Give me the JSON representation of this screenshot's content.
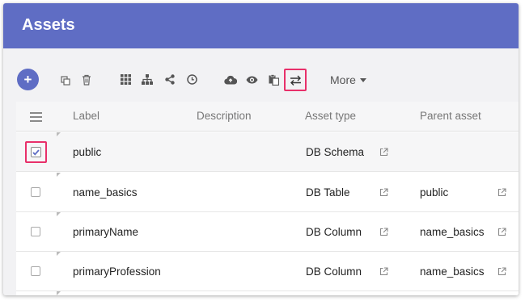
{
  "header": {
    "title": "Assets",
    "color": "#5f6dc4"
  },
  "toolbar": {
    "add_label": "+",
    "more_label": "More",
    "icons": [
      "add-icon",
      "copy-icon",
      "trash-icon",
      "grid-icon",
      "hierarchy-icon",
      "share-icon",
      "clock-icon",
      "cloud-upload-icon",
      "eye-icon",
      "clipboard-icon",
      "swap-arrows-icon"
    ],
    "highlight_color": "#e8306a"
  },
  "table": {
    "columns": [
      "Label",
      "Description",
      "Asset type",
      "Parent asset"
    ],
    "rows": [
      {
        "label": "public",
        "description": "",
        "asset_type": "DB Schema",
        "parent": "",
        "checked": true
      },
      {
        "label": "name_basics",
        "description": "",
        "asset_type": "DB Table",
        "parent": "public",
        "checked": false
      },
      {
        "label": "primaryName",
        "description": "",
        "asset_type": "DB Column",
        "parent": "name_basics",
        "checked": false
      },
      {
        "label": "primaryProfession",
        "description": "",
        "asset_type": "DB Column",
        "parent": "name_basics",
        "checked": false
      }
    ]
  }
}
